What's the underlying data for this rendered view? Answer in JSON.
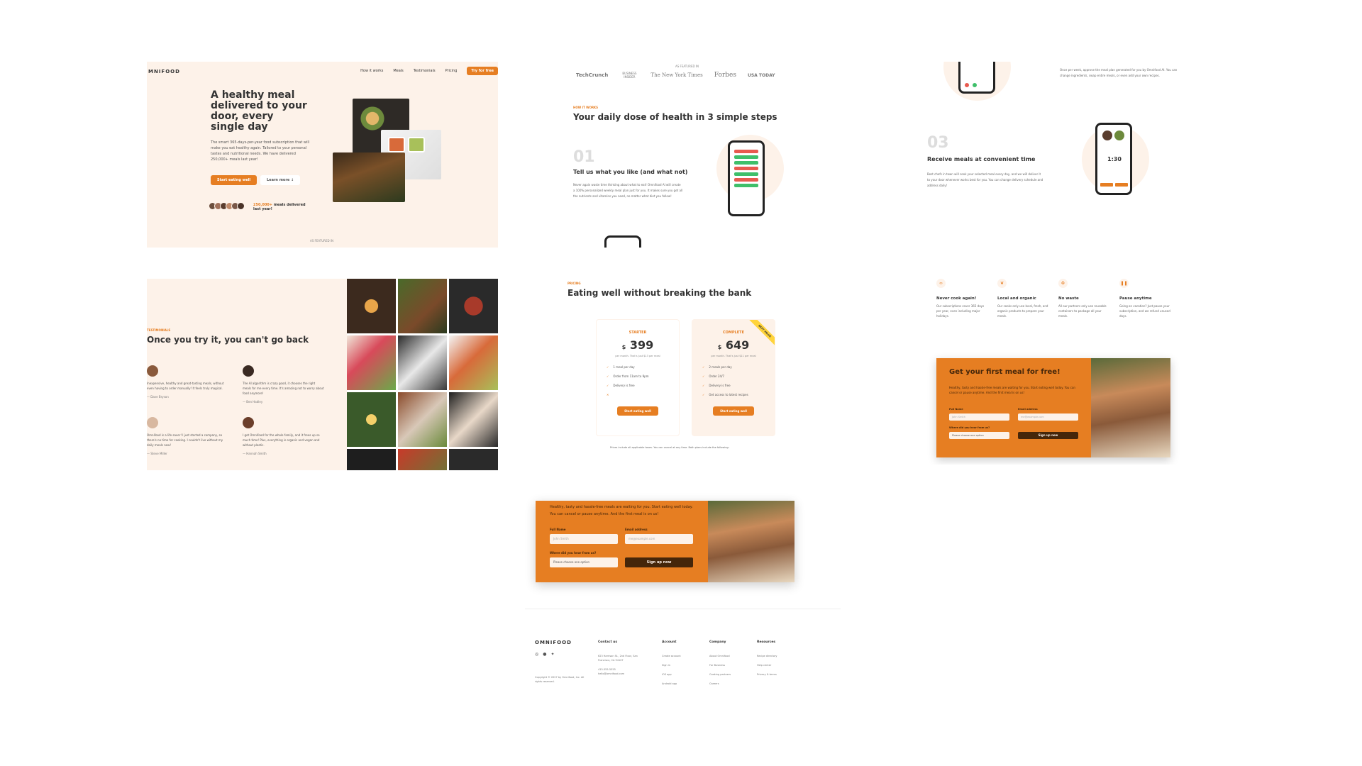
{
  "hero": {
    "logo": "MNIFOOD",
    "nav": [
      "How it works",
      "Meals",
      "Testimonials",
      "Pricing"
    ],
    "nav_cta": "Try for free",
    "title": "A healthy meal delivered to your door, every single day",
    "description": "The smart 365-days-per-year food subscription that will make you eat healthy again. Tailored to your personal tastes and nutritional needs. We have delivered 250,000+ meals last year!",
    "primary_button": "Start eating well",
    "secondary_button": "Learn more ↓",
    "delivered_highlight": "250,000+",
    "delivered_text": " meals delivered last year!",
    "featured_label": "AS FEATURED IN"
  },
  "how": {
    "featured_label": "AS FEATURED IN",
    "logos": [
      "TechCrunch",
      "BUSINESS INSIDER",
      "The New York Times",
      "Forbes",
      "USA TODAY"
    ],
    "subheading": "HOW IT WORKS",
    "title": "Your daily dose of health in 3 simple steps",
    "step_num": "01",
    "step_title": "Tell us what you like (and what not)",
    "step_text": "Never again waste time thinking about what to eat! Omnifood AI will create a 100% personalized weekly meal plan just for you. It makes sure you get all the nutrients and vitamins you need, no matter what diet you follow!"
  },
  "steps": {
    "top_text": "Once per week, approve the meal plan generated for you by Omnifood AI. You can change ingredients, swap entire meals, or even add your own recipes.",
    "step_num": "03",
    "step_title": "Receive meals at convenient time",
    "step_text": "Best chefs in town will cook your selected meal every day, and we will deliver it to your door whenever works best for you. You can change delivery schedule and address daily!",
    "phone_time": "1:30"
  },
  "testimonials": {
    "subheading": "TESTIMONIALS",
    "title": "Once you try it, you can't go back",
    "items": [
      {
        "quote": "Inexpensive, healthy and great-tasting meals, without even having to order manually! It feels truly magical.",
        "name": "— Dave Bryson"
      },
      {
        "quote": "The AI algorithm is crazy good, it chooses the right meals for me every time. It's amazing not to worry about food anymore!",
        "name": "— Ben Hadley"
      },
      {
        "quote": "Omnifood is a life saver! I just started a company, so there's no time for cooking. I couldn't live without my daily meals now!",
        "name": "— Steve Miller"
      },
      {
        "quote": "I got Omnifood for the whole family, and it frees up so much time! Plus, everything is organic and vegan and without plastic.",
        "name": "— Hannah Smith"
      }
    ]
  },
  "pricing": {
    "subheading": "PRICING",
    "title": "Eating well without breaking the bank",
    "plans": [
      {
        "name": "STARTER",
        "currency": "$",
        "price": "399",
        "per": "per month. That's just $13 per meal",
        "features": [
          "1 meal per day",
          "Order from 11am to 9pm",
          "Delivery is free",
          ""
        ],
        "button": "Start eating well"
      },
      {
        "name": "COMPLETE",
        "currency": "$",
        "price": "649",
        "per": "per month. That's just $11 per meal",
        "features": [
          "2 meals per day",
          "Order 24/7",
          "Delivery is free",
          "Get access to latest recipes"
        ],
        "button": "Start eating well",
        "ribbon": "BEST VALUE"
      }
    ],
    "fine_print": "Prices include all applicable taxes. You can cancel at any time. Both plans include the following:"
  },
  "features": {
    "items": [
      {
        "title": "Never cook again!",
        "text": "Our subscriptions cover 365 days per year, even including major holidays."
      },
      {
        "title": "Local and organic",
        "text": "Our cooks only use local, fresh, and organic products to prepare your meals."
      },
      {
        "title": "No waste",
        "text": "All our partners only use reusable containers to package all your meals."
      },
      {
        "title": "Pause anytime",
        "text": "Going on vacation? Just pause your subscription, and we refund unused days."
      }
    ],
    "cta_title": "Get your first meal for free!",
    "cta_text": "Healthy, tasty and hassle-free meals are waiting for you. Start eating well today. You can cancel or pause anytime. And the first meal is on us!",
    "full_name_label": "Full Name",
    "full_name_placeholder": "John Smith",
    "email_label": "Email address",
    "email_placeholder": "me@example.com",
    "source_label": "Where did you hear from us?",
    "source_value": "Please choose one option",
    "submit": "Sign up now"
  },
  "cta2": {
    "text": "Healthy, tasty and hassle-free meals are waiting for you. Start eating well today. You can cancel or pause anytime. And the first meal is on us!",
    "full_name_label": "Full Name",
    "full_name_placeholder": "John Smith",
    "email_label": "Email address",
    "email_placeholder": "me@example.com",
    "source_label": "Where did you hear from us?",
    "source_value": "Please choose one option",
    "submit": "Sign up now"
  },
  "footer": {
    "logo": "OMNIFOOD",
    "copyright": "Copyright © 2027 by Omnifood, Inc. All rights reserved.",
    "contact_title": "Contact us",
    "contact": [
      "623 Harrison St., 2nd Floor, San Francisco, CA 94107",
      "415-555-5555",
      "hello@omnifood.com"
    ],
    "account_title": "Account",
    "account": [
      "Create account",
      "Sign in",
      "iOS app",
      "Android app"
    ],
    "company_title": "Company",
    "company": [
      "About Omnifood",
      "For Business",
      "Cooking partners",
      "Careers"
    ],
    "resources_title": "Resources",
    "resources": [
      "Recipe directory",
      "Help center",
      "Privacy & terms"
    ]
  },
  "colors": {
    "primary": "#e67e22",
    "tint": "#fdf2e9",
    "dark": "#45260a"
  }
}
